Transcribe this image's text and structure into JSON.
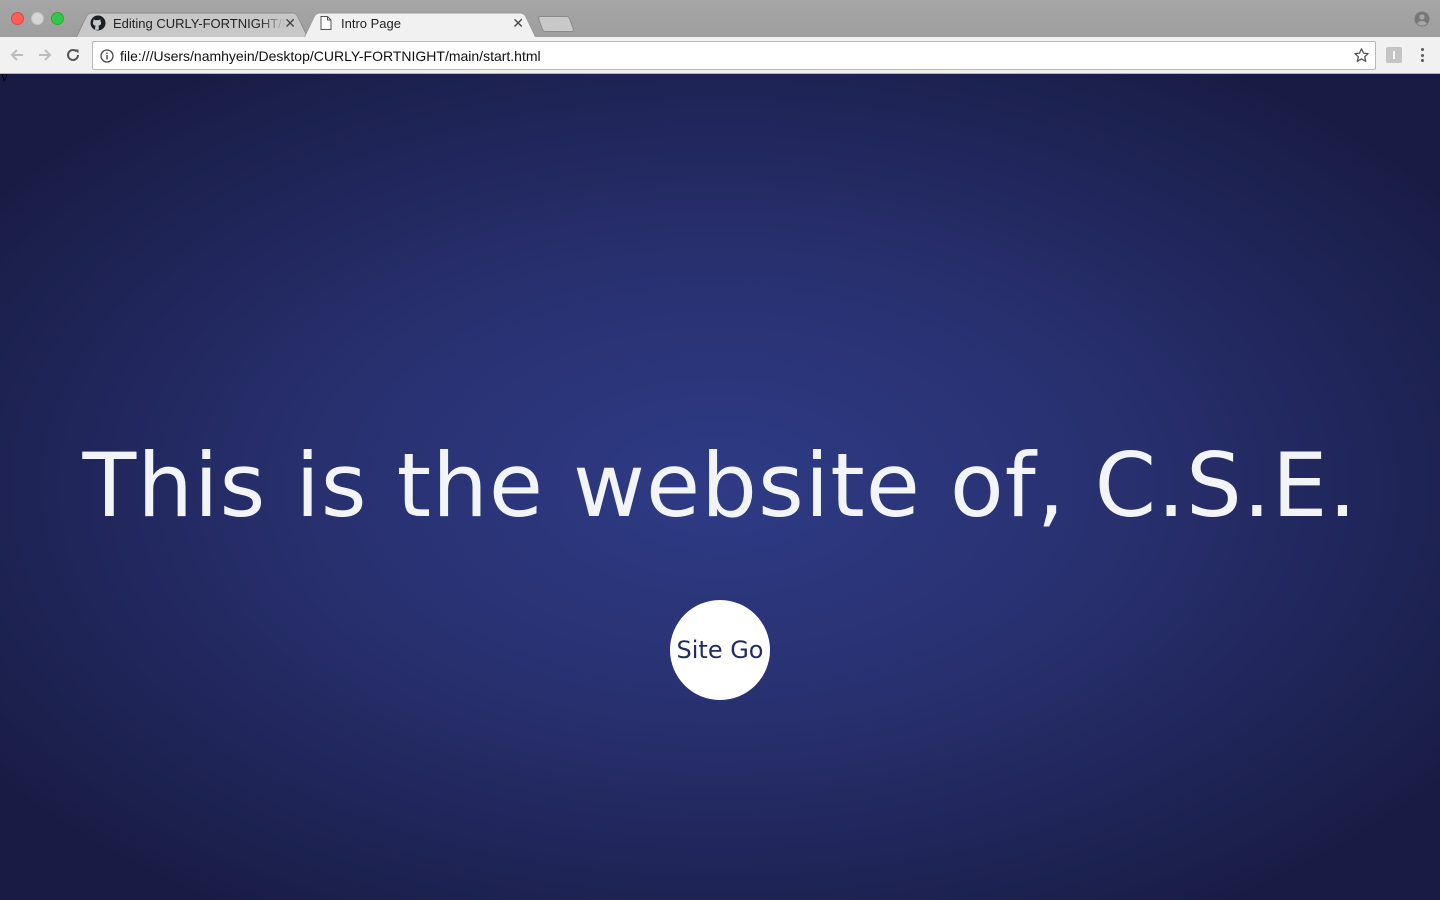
{
  "browser": {
    "tabs": [
      {
        "title": "Editing CURLY-FORTNIGHT/README.md",
        "active": false,
        "favicon": "github-icon"
      },
      {
        "title": "Intro Page",
        "active": true,
        "favicon": "document-icon"
      }
    ],
    "address_bar": {
      "url": "file:///Users/namhyein/Desktop/CURLY-FORTNIGHT/main/start.html"
    }
  },
  "page": {
    "stray_text": "v",
    "headline": "This is the website of, C.S.E.",
    "button_label": "Site Go"
  },
  "colors": {
    "background_center": "#2e3b85",
    "background_edge": "#181c44",
    "headline": "#f3f4f8",
    "button_bg": "#ffffff",
    "button_text": "#232c62"
  }
}
